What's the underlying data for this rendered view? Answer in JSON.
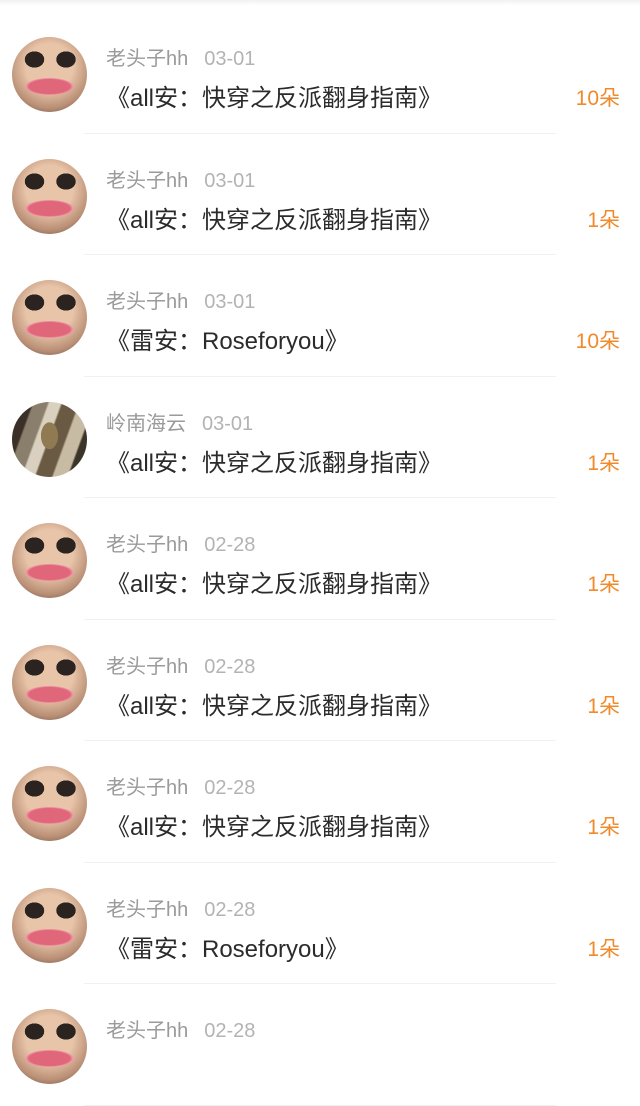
{
  "items": [
    {
      "name": "老头子hh",
      "date": "03-01",
      "title": "《all安：快穿之反派翻身指南》",
      "amount": "10朵",
      "avatar": "face-avatar"
    },
    {
      "name": "老头子hh",
      "date": "03-01",
      "title": "《all安：快穿之反派翻身指南》",
      "amount": "1朵",
      "avatar": "face-avatar"
    },
    {
      "name": "老头子hh",
      "date": "03-01",
      "title": "《雷安：Roseforyou》",
      "amount": "10朵",
      "avatar": "face-avatar"
    },
    {
      "name": "岭南海云",
      "date": "03-01",
      "title": "《all安：快穿之反派翻身指南》",
      "amount": "1朵",
      "avatar": "scene-avatar"
    },
    {
      "name": "老头子hh",
      "date": "02-28",
      "title": "《all安：快穿之反派翻身指南》",
      "amount": "1朵",
      "avatar": "face-avatar"
    },
    {
      "name": "老头子hh",
      "date": "02-28",
      "title": "《all安：快穿之反派翻身指南》",
      "amount": "1朵",
      "avatar": "face-avatar"
    },
    {
      "name": "老头子hh",
      "date": "02-28",
      "title": "《all安：快穿之反派翻身指南》",
      "amount": "1朵",
      "avatar": "face-avatar"
    },
    {
      "name": "老头子hh",
      "date": "02-28",
      "title": "《雷安：Roseforyou》",
      "amount": "1朵",
      "avatar": "face-avatar"
    },
    {
      "name": "老头子hh",
      "date": "02-28",
      "title": "",
      "amount": "",
      "avatar": "face-avatar"
    }
  ],
  "colors": {
    "accent": "#f08a2a",
    "name_gray": "#9a9a9a",
    "date_gray": "#b3b3b3",
    "title_text": "#2b2b2b"
  }
}
